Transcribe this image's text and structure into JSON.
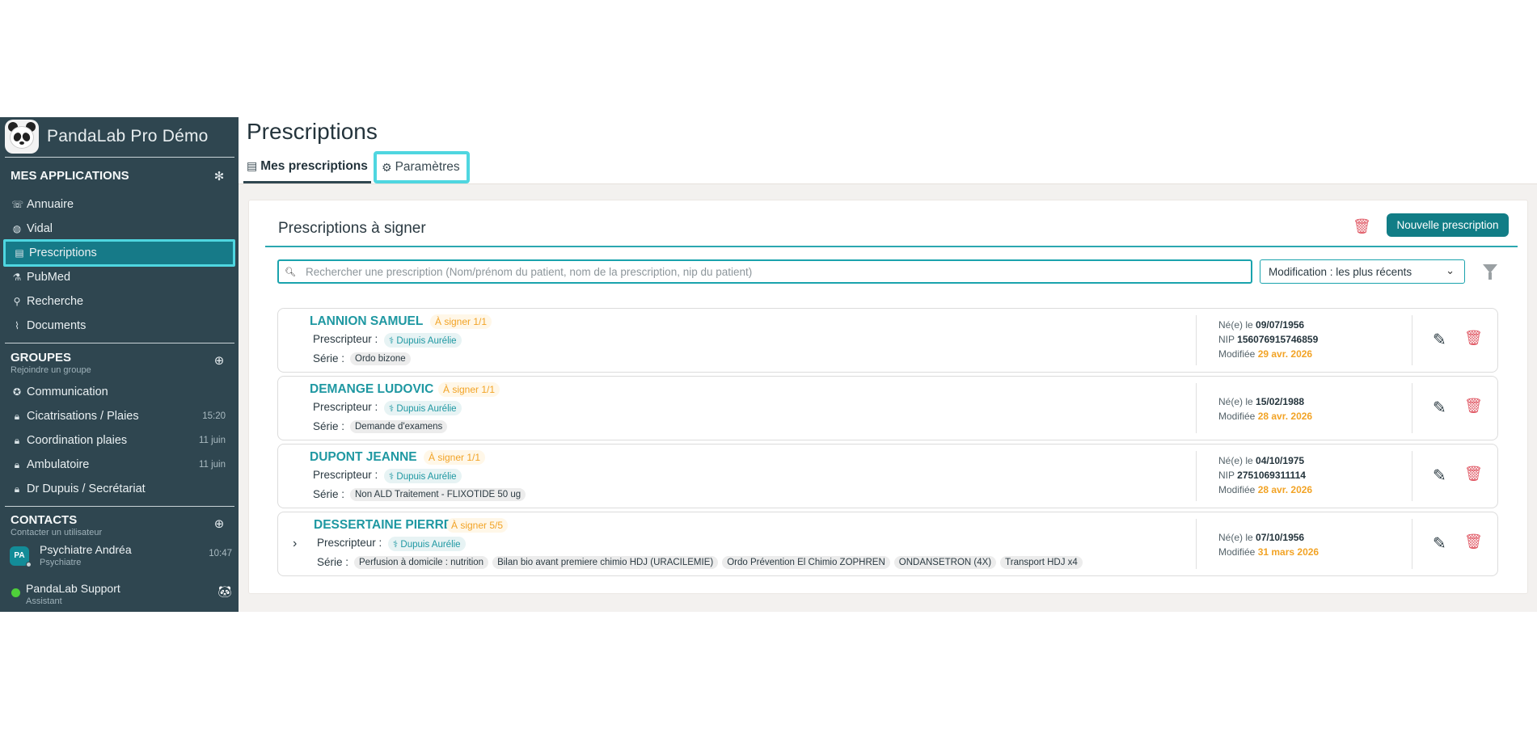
{
  "app": {
    "title": "PandaLab Pro Démo"
  },
  "sidebar": {
    "apps_header": "MES APPLICATIONS",
    "apps": [
      {
        "label": "Annuaire",
        "icon": "phone-icon"
      },
      {
        "label": "Vidal",
        "icon": "pill-icon"
      },
      {
        "label": "Prescriptions",
        "icon": "prescription-icon",
        "active": true
      },
      {
        "label": "PubMed",
        "icon": "pubmed-icon"
      },
      {
        "label": "Recherche",
        "icon": "search-icon"
      },
      {
        "label": "Documents",
        "icon": "paperclip-icon"
      }
    ],
    "groups_header": "GROUPES",
    "groups_sub": "Rejoindre un groupe",
    "groups": [
      {
        "label": "Communication",
        "time": ""
      },
      {
        "label": "Cicatrisations / Plaies",
        "time": "15:20"
      },
      {
        "label": "Coordination plaies",
        "time": "11 juin"
      },
      {
        "label": "Ambulatoire",
        "time": "11 juin"
      },
      {
        "label": "Dr Dupuis / Secrétariat",
        "time": ""
      }
    ],
    "contacts_header": "CONTACTS",
    "contacts_sub": "Contacter un utilisateur",
    "contacts": [
      {
        "initials": "PA",
        "name": "Psychiatre Andréa",
        "role": "Psychiatre",
        "time": "10:47"
      },
      {
        "initials": "",
        "name": "PandaLab Support",
        "role": "Assistant",
        "time": ""
      }
    ]
  },
  "main": {
    "title": "Prescriptions",
    "tabs": [
      {
        "label": "Mes prescriptions"
      },
      {
        "label": "Paramètres"
      }
    ],
    "card_title": "Prescriptions à signer",
    "new_button": "Nouvelle prescription",
    "search_placeholder": "Rechercher une prescription (Nom/prénom du patient, nom de la prescription, nip du patient)",
    "sort_value": "Modification : les plus récents",
    "labels": {
      "prescriber": "Prescripteur :",
      "series": "Série :",
      "born": "Né(e) le",
      "nip": "NIP",
      "modified": "Modifiée"
    },
    "rows": [
      {
        "name": "LANNION SAMUEL",
        "status": "À signer 1/1",
        "prescriber": "Dupuis Aurélie",
        "series": [
          "Ordo bizone"
        ],
        "born": "09/07/1956",
        "nip": "156076915746859",
        "modified": "29 avr. 2026"
      },
      {
        "name": "DEMANGE LUDOVIC",
        "status": "À signer 1/1",
        "prescriber": "Dupuis Aurélie",
        "series": [
          "Demande d'examens"
        ],
        "born": "15/02/1988",
        "nip": "",
        "modified": "28 avr. 2026"
      },
      {
        "name": "DUPONT JEANNE",
        "status": "À signer 1/1",
        "prescriber": "Dupuis Aurélie",
        "series": [
          "Non ALD Traitement - FLIXOTIDE 50 ug"
        ],
        "born": "04/10/1975",
        "nip": "2751069311114",
        "modified": "28 avr. 2026"
      },
      {
        "name": "DESSERTAINE PIERRE",
        "status": "À signer 5/5",
        "prescriber": "Dupuis Aurélie",
        "series": [
          "Perfusion à domicile : nutrition",
          "Bilan bio avant premiere chimio HDJ (URACILEMIE)",
          "Ordo Prévention El Chimio ZOPHREN",
          "ONDANSETRON (4X)",
          "Transport HDJ x4"
        ],
        "born": "07/10/1956",
        "nip": "",
        "modified": "31 mars 2026"
      }
    ]
  },
  "colors": {
    "sidebar": "#2f4650",
    "accent": "#117d86",
    "highlight": "#4fd6e0",
    "warning": "#f2a325",
    "danger": "#e05a66"
  }
}
